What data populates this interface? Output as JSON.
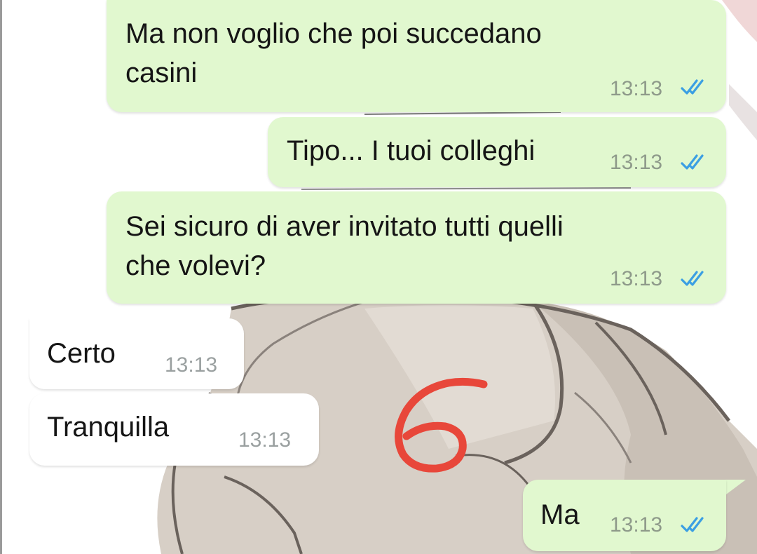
{
  "chat": {
    "messages": [
      {
        "direction": "outgoing",
        "lines": [
          "Ma non voglio che poi succedano",
          "casini"
        ],
        "time": "13:13",
        "status": "read-double-check-icon"
      },
      {
        "direction": "outgoing",
        "lines": [
          "Tipo... I tuoi colleghi"
        ],
        "time": "13:13",
        "status": "read-double-check-icon"
      },
      {
        "direction": "outgoing",
        "lines": [
          "Sei sicuro di aver invitato tutti quelli",
          "che volevi?"
        ],
        "time": "13:13",
        "status": "read-double-check-icon"
      },
      {
        "direction": "incoming",
        "lines": [
          "Certo"
        ],
        "time": "13:13"
      },
      {
        "direction": "incoming",
        "lines": [
          "Tranquilla"
        ],
        "time": "13:13"
      },
      {
        "direction": "outgoing",
        "lines": [
          "Ma"
        ],
        "time": "13:13",
        "status": "read-double-check-icon"
      }
    ]
  },
  "annotation": {
    "text": "6",
    "color": "#e8473a"
  },
  "colors": {
    "outgoing_bubble": "#e1f8cf",
    "incoming_bubble": "#ffffff",
    "read_ticks": "#3b9fe3",
    "timestamp": "#8e9a8a"
  }
}
